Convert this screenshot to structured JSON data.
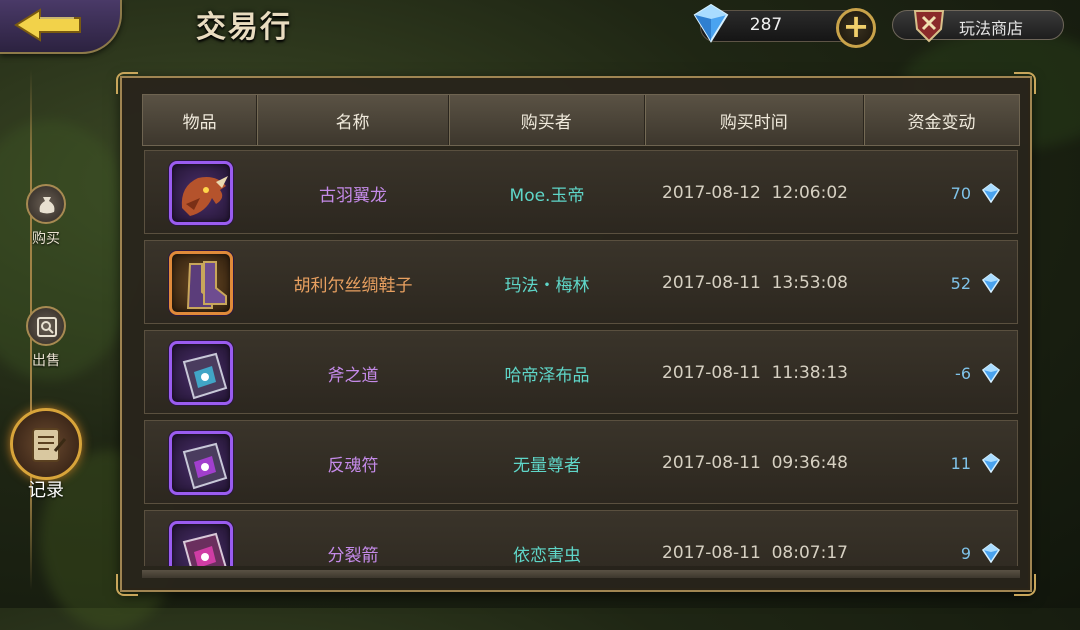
{
  "header": {
    "title": "交易行",
    "diamond_amount": "287",
    "shop_label": "玩法商店"
  },
  "sidebar": {
    "items": [
      {
        "label": "购买"
      },
      {
        "label": "出售"
      },
      {
        "label": "记录",
        "active": true
      }
    ]
  },
  "table": {
    "columns": [
      "物品",
      "名称",
      "购买者",
      "购买时间",
      "资金变动"
    ],
    "rows": [
      {
        "icon": "dragon-icon",
        "rarity": "purple",
        "name": "古羽翼龙",
        "buyer": "Moe.玉帝",
        "time": "2017-08-12  12:06:02",
        "change": "70"
      },
      {
        "icon": "boots-icon",
        "rarity": "orange",
        "name": "胡利尔丝绸鞋子",
        "buyer": "玛法・梅林",
        "time": "2017-08-11  13:53:08",
        "change": "52"
      },
      {
        "icon": "book-icon",
        "rarity": "purple",
        "name": "斧之道",
        "buyer": "哈帝泽布品",
        "time": "2017-08-11  11:38:13",
        "change": "-6"
      },
      {
        "icon": "book-icon",
        "rarity": "purple",
        "name": "反魂符",
        "buyer": "无量尊者",
        "time": "2017-08-11  09:36:48",
        "change": "11"
      },
      {
        "icon": "book-icon",
        "rarity": "purple",
        "name": "分裂箭",
        "buyer": "依恋害虫",
        "time": "2017-08-11  08:07:17",
        "change": "9"
      }
    ]
  },
  "colors": {
    "accent_gold": "#c8a65b",
    "buyer_teal": "#5fd6c8",
    "purple_name": "#c48ae8",
    "orange_name": "#e8a060",
    "diamond_blue": "#7fc2e8"
  }
}
